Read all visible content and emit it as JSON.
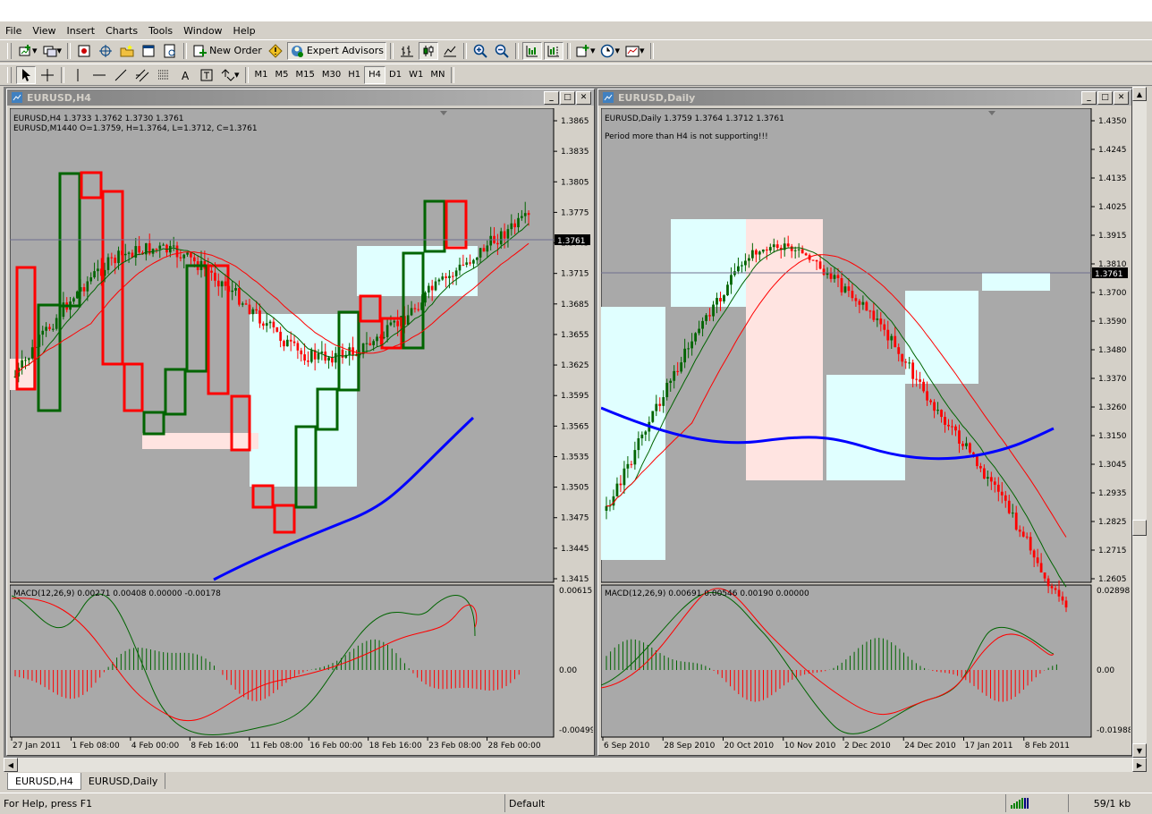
{
  "menu": [
    "File",
    "View",
    "Insert",
    "Charts",
    "Tools",
    "Window",
    "Help"
  ],
  "toolbar": {
    "new_order": "New Order",
    "expert_advisors": "Expert Advisors"
  },
  "periods": [
    "M1",
    "M5",
    "M15",
    "M30",
    "H1",
    "H4",
    "D1",
    "W1",
    "MN"
  ],
  "active_period": "H4",
  "colors": {
    "chart_bg": "#a9a9a9",
    "bull": "#006400",
    "bear": "#ff0000",
    "ma_slow": "#0000ff",
    "zone_up": "#e0ffff",
    "zone_down": "#ffe4e1"
  },
  "windows": [
    {
      "title": "EURUSD,H4",
      "info1": "EURUSD,H4  1.3733 1.3762 1.3730 1.3761",
      "info2": "EURUSD,M1440   O=1.3759,  H=1.3764,  L=1.3712,  C=1.3761",
      "price_label": "1.3761",
      "price_axis": [
        "1.3865",
        "1.3835",
        "1.3805",
        "1.3775",
        "1.3745",
        "1.3715",
        "1.3685",
        "1.3655",
        "1.3625",
        "1.3595",
        "1.3565",
        "1.3535",
        "1.3505",
        "1.3475",
        "1.3445",
        "1.3415"
      ],
      "macd_label": "MACD(12,26,9) 0.00271 0.00408 0.00000 -0.00178",
      "macd_axis": [
        "0.00615",
        "0.00",
        "-0.00499"
      ],
      "time_axis": [
        "27 Jan 2011",
        "1 Feb 08:00",
        "4 Feb 00:00",
        "8 Feb 16:00",
        "11 Feb 08:00",
        "16 Feb 00:00",
        "18 Feb 16:00",
        "23 Feb 08:00",
        "28 Feb 00:00"
      ]
    },
    {
      "title": "EURUSD,Daily",
      "info1": "EURUSD,Daily  1.3759 1.3764 1.3712 1.3761",
      "info2": "Period more than H4 is not supporting!!!",
      "price_label": "1.3761",
      "price_axis": [
        "1.4350",
        "1.4245",
        "1.4135",
        "1.4025",
        "1.3915",
        "1.3810",
        "1.3700",
        "1.3590",
        "1.3480",
        "1.3370",
        "1.3260",
        "1.3150",
        "1.3045",
        "1.2935",
        "1.2825",
        "1.2715",
        "1.2605"
      ],
      "macd_label": "MACD(12,26,9) 0.00691 0.00546 0.00190 0.00000",
      "macd_axis": [
        "0.02898",
        "0.00",
        "-0.01988"
      ],
      "time_axis": [
        "6 Sep 2010",
        "28 Sep 2010",
        "20 Oct 2010",
        "10 Nov 2010",
        "2 Dec 2010",
        "24 Dec 2010",
        "17 Jan 2011",
        "8 Feb 2011"
      ]
    }
  ],
  "tabs": [
    "EURUSD,H4",
    "EURUSD,Daily"
  ],
  "status": {
    "help": "For Help, press F1",
    "profile": "Default",
    "traffic": "59/1 kb"
  }
}
